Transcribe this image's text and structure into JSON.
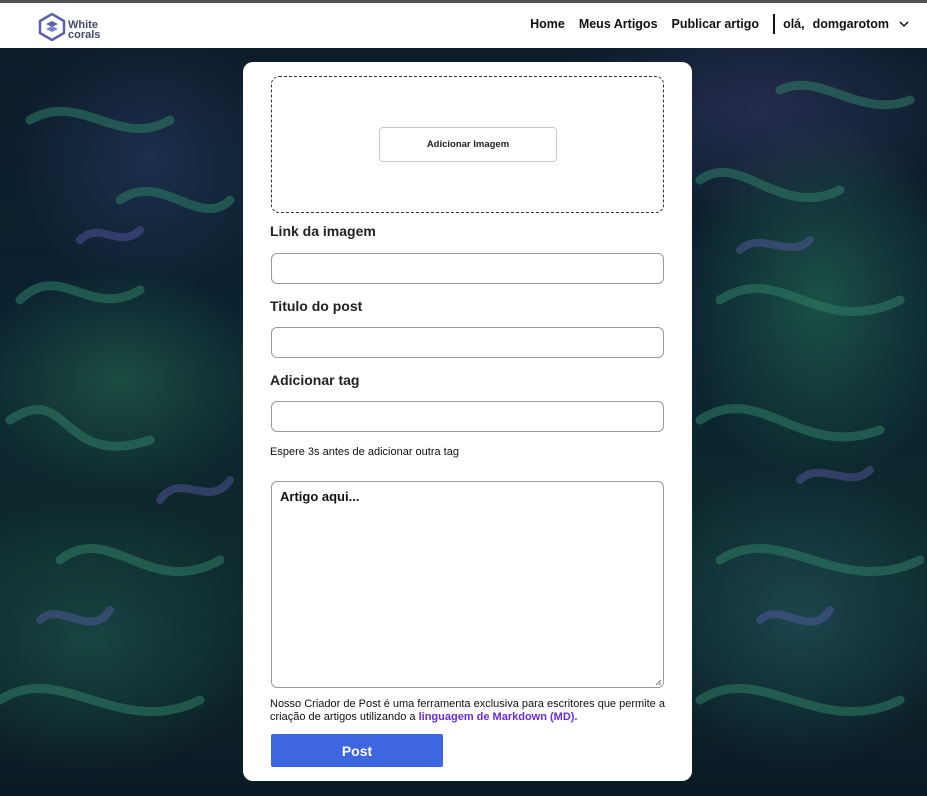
{
  "header": {
    "logo": {
      "line1": "White",
      "line2": "corals",
      "icon": "white-corals-logo-icon"
    },
    "nav": [
      {
        "label": "Home"
      },
      {
        "label": "Meus Artigos"
      },
      {
        "label": "Publicar artigo"
      }
    ],
    "user": {
      "greeting": "olá,",
      "username": "domgarotom",
      "icon": "chevron-down-icon"
    }
  },
  "form": {
    "add_image_button": "Adicionar Imagem",
    "image_link_label": "Link da imagem",
    "image_link_value": "",
    "title_label": "Titulo do post",
    "title_value": "",
    "tag_label": "Adicionar tag",
    "tag_value": "",
    "tag_hint": "Espere 3s antes de adicionar outra tag",
    "article_placeholder": "Artigo aqui...",
    "note_text": "Nosso Criador de Post é uma ferramenta exclusiva para escritores que permite a criação de artigos utilizando a ",
    "note_link": "linguagem de Markdown (MD).",
    "post_button": "Post"
  },
  "colors": {
    "primary_button": "#3d66e0",
    "link": "#6a2ce0",
    "logo": "#444a6a"
  }
}
